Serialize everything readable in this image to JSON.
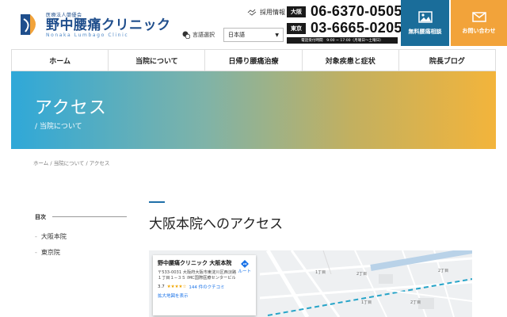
{
  "header": {
    "logo_small": "医療法人蘭優会",
    "logo_main": "野中腰痛クリニック",
    "logo_sub": "Nonaka Lumbago Clinic",
    "recruit": "採用情報",
    "lang_label": "言語選択",
    "lang_value": "日本語",
    "phones": [
      {
        "badge": "大阪",
        "number": "06-6370-0505"
      },
      {
        "badge": "東京",
        "number": "03-6665-0205"
      }
    ],
    "hours": "電話受付時間　9:00 ~ 17:00（月曜日～土曜日）",
    "consult_label": "無料腰痛相談",
    "contact_label": "お問い合わせ"
  },
  "nav": [
    "ホーム",
    "当院について",
    "日帰り腰痛治療",
    "対象疾患と症状",
    "院長ブログ"
  ],
  "hero": {
    "title": "アクセス",
    "subtitle": "/ 当院について"
  },
  "breadcrumb": "ホーム / 当院について / アクセス",
  "toc": {
    "title": "目次",
    "items": [
      "大阪本院",
      "東京院"
    ]
  },
  "main": {
    "title": "大阪本院へのアクセス"
  },
  "map": {
    "name": "野中腰痛クリニック 大阪本院",
    "address": "〒533-0031 大阪府大阪市東淀川区西淡路１丁目１−３５ IMC国際医療センタービル",
    "rating": "3.7",
    "stars": "★★★★☆",
    "reviews": "144 件のクチコミ",
    "enlarge": "拡大地図を表示",
    "route": "ルート",
    "labels": [
      "1丁目",
      "2丁目",
      "1丁目",
      "2丁目",
      "2丁目"
    ]
  },
  "colors": {
    "brand_blue": "#1f4e8c",
    "consult_bg": "#1a6d9a",
    "contact_bg": "#f2a33a"
  }
}
